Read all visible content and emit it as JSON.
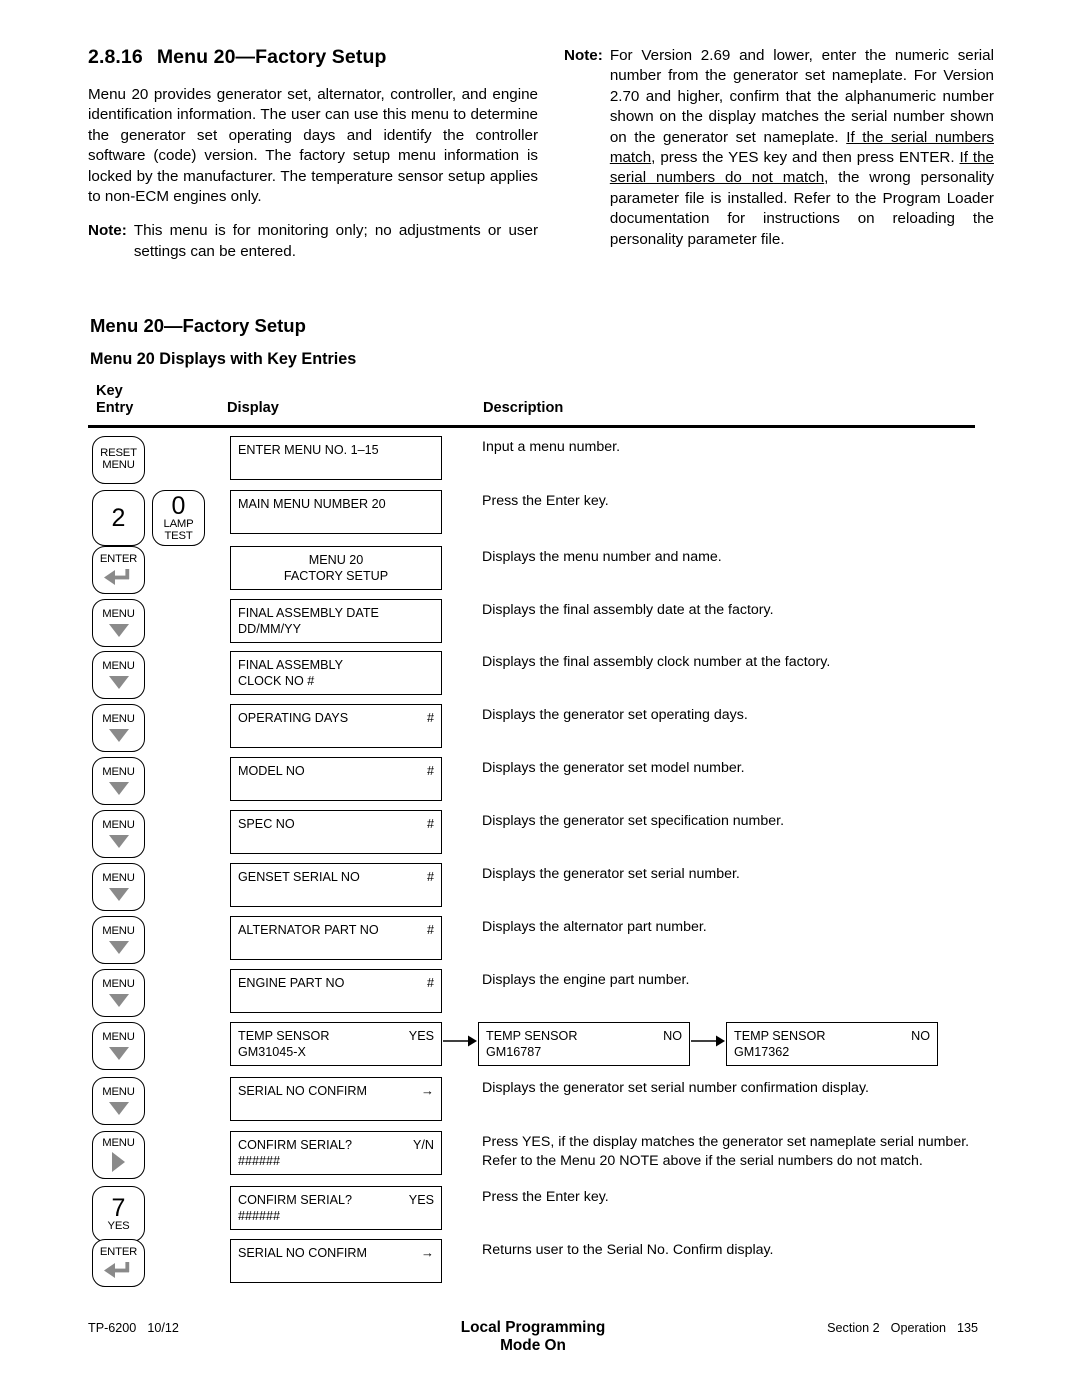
{
  "section": {
    "number": "2.8.16",
    "title": "Menu 20—Factory Setup",
    "paragraph": "Menu 20 provides generator set, alternator, controller, and engine identification information.  The user can use this menu to determine the generator set operating days and identify the controller software (code) version.  The factory setup menu information is locked by the manufacturer.  The temperature sensor setup applies to non-ECM engines only.",
    "note_label": "Note:",
    "note_text": "This menu is for monitoring only; no adjustments or user settings can be entered."
  },
  "right_note": {
    "label": "Note:",
    "part1": "For Version 2.69 and lower, enter the numeric serial number from the generator set nameplate.  For Version 2.70 and higher, confirm that the alphanumeric number shown on the display matches the serial number shown on the generator set nameplate.  ",
    "underline1": "If the serial numbers match",
    "part2": ", press the YES key and then press ENTER.  ",
    "underline2": "If the serial numbers do not match",
    "part3": ", the wrong personality parameter file is installed.  Refer to the Program Loader documentation for instructions on reloading the personality parameter file."
  },
  "table": {
    "heading": "Menu 20—Factory Setup",
    "subheading": "Menu 20 Displays with Key Entries",
    "headers": {
      "key_line1": "Key",
      "key_line2": "Entry",
      "display": "Display",
      "description": "Description"
    },
    "rows": [
      {
        "keys": [
          {
            "type": "text2",
            "line1": "RESET",
            "line2": "MENU"
          }
        ],
        "display": {
          "lines": [
            {
              "left": "ENTER MENU NO. 1–15",
              "right": ""
            }
          ]
        },
        "description": "Input a menu number."
      },
      {
        "keys": [
          {
            "type": "big",
            "big": "2"
          },
          {
            "type": "biglabel",
            "big": "0",
            "line1": "LAMP",
            "line2": "TEST"
          }
        ],
        "display": {
          "lines": [
            {
              "left": "MAIN MENU NUMBER 20",
              "right": ""
            }
          ]
        },
        "description": "Press the Enter key."
      },
      {
        "keys": [
          {
            "type": "enter",
            "line1": "ENTER"
          }
        ],
        "display": {
          "center": true,
          "lines": [
            {
              "left": "MENU 20",
              "right": ""
            },
            {
              "left": "FACTORY SETUP",
              "right": ""
            }
          ]
        },
        "description": "Displays the menu number and name."
      },
      {
        "keys": [
          {
            "type": "down",
            "line1": "MENU"
          }
        ],
        "display": {
          "lines": [
            {
              "left": "FINAL ASSEMBLY DATE",
              "right": ""
            },
            {
              "left": "DD/MM/YY",
              "right": ""
            }
          ]
        },
        "description": "Displays the final assembly date at the factory."
      },
      {
        "keys": [
          {
            "type": "down",
            "line1": "MENU"
          }
        ],
        "display": {
          "lines": [
            {
              "left": "FINAL ASSEMBLY",
              "right": ""
            },
            {
              "left": "CLOCK NO #",
              "right": ""
            }
          ]
        },
        "description": "Displays the final assembly clock number at the factory."
      },
      {
        "keys": [
          {
            "type": "down",
            "line1": "MENU"
          }
        ],
        "display": {
          "lines": [
            {
              "left": "OPERATING DAYS",
              "right": "#"
            }
          ]
        },
        "description": "Displays the generator set operating days."
      },
      {
        "keys": [
          {
            "type": "down",
            "line1": "MENU"
          }
        ],
        "display": {
          "lines": [
            {
              "left": "MODEL NO",
              "right": "#"
            }
          ]
        },
        "description": "Displays the generator set model number."
      },
      {
        "keys": [
          {
            "type": "down",
            "line1": "MENU"
          }
        ],
        "display": {
          "lines": [
            {
              "left": "SPEC NO",
              "right": "#"
            }
          ]
        },
        "description": "Displays the generator set specification number."
      },
      {
        "keys": [
          {
            "type": "down",
            "line1": "MENU"
          }
        ],
        "display": {
          "lines": [
            {
              "left": "GENSET SERIAL NO",
              "right": "#"
            }
          ]
        },
        "description": "Displays the generator set serial number."
      },
      {
        "keys": [
          {
            "type": "down",
            "line1": "MENU"
          }
        ],
        "display": {
          "lines": [
            {
              "left": "ALTERNATOR PART NO",
              "right": "#"
            }
          ]
        },
        "description": "Displays the alternator part number."
      },
      {
        "keys": [
          {
            "type": "down",
            "line1": "MENU"
          }
        ],
        "display": {
          "lines": [
            {
              "left": "ENGINE PART NO",
              "right": "#"
            }
          ]
        },
        "description": "Displays the engine part number."
      },
      {
        "keys": [
          {
            "type": "down",
            "line1": "MENU"
          }
        ],
        "chain": [
          {
            "lines": [
              {
                "left": "TEMP SENSOR",
                "right": "YES"
              },
              {
                "left": "GM31045-X",
                "right": ""
              }
            ]
          },
          {
            "lines": [
              {
                "left": "TEMP SENSOR",
                "right": "NO"
              },
              {
                "left": "GM16787",
                "right": ""
              }
            ]
          },
          {
            "lines": [
              {
                "left": "TEMP SENSOR",
                "right": "NO"
              },
              {
                "left": "GM17362",
                "right": ""
              }
            ]
          }
        ],
        "description": ""
      },
      {
        "keys": [
          {
            "type": "down",
            "line1": "MENU"
          }
        ],
        "display": {
          "lines": [
            {
              "left": "SERIAL NO CONFIRM",
              "right": "→"
            }
          ]
        },
        "description": "Displays the generator set serial number confirmation display."
      },
      {
        "keys": [
          {
            "type": "right",
            "line1": "MENU"
          }
        ],
        "display": {
          "lines": [
            {
              "left": "CONFIRM SERIAL?",
              "right": "Y/N"
            },
            {
              "left": "######",
              "right": ""
            }
          ]
        },
        "description": "Press YES, if the display matches the generator set nameplate serial number.  Refer to the Menu 20 NOTE above if the serial numbers do not match."
      },
      {
        "keys": [
          {
            "type": "biglabel2",
            "big": "7",
            "line1": "YES"
          }
        ],
        "display": {
          "lines": [
            {
              "left": "CONFIRM SERIAL?",
              "right": "YES"
            },
            {
              "left": "######",
              "right": ""
            }
          ]
        },
        "description": "Press the Enter key."
      },
      {
        "keys": [
          {
            "type": "enter",
            "line1": "ENTER"
          }
        ],
        "display": {
          "lines": [
            {
              "left": "SERIAL NO CONFIRM",
              "right": "→"
            }
          ]
        },
        "description": "Returns user to the Serial No. Confirm display."
      }
    ]
  },
  "footer": {
    "doc": "TP-6200",
    "date": "10/12",
    "center": "Local Programming Mode On",
    "section": "Section 2",
    "chapter": "Operation",
    "page": "135"
  }
}
